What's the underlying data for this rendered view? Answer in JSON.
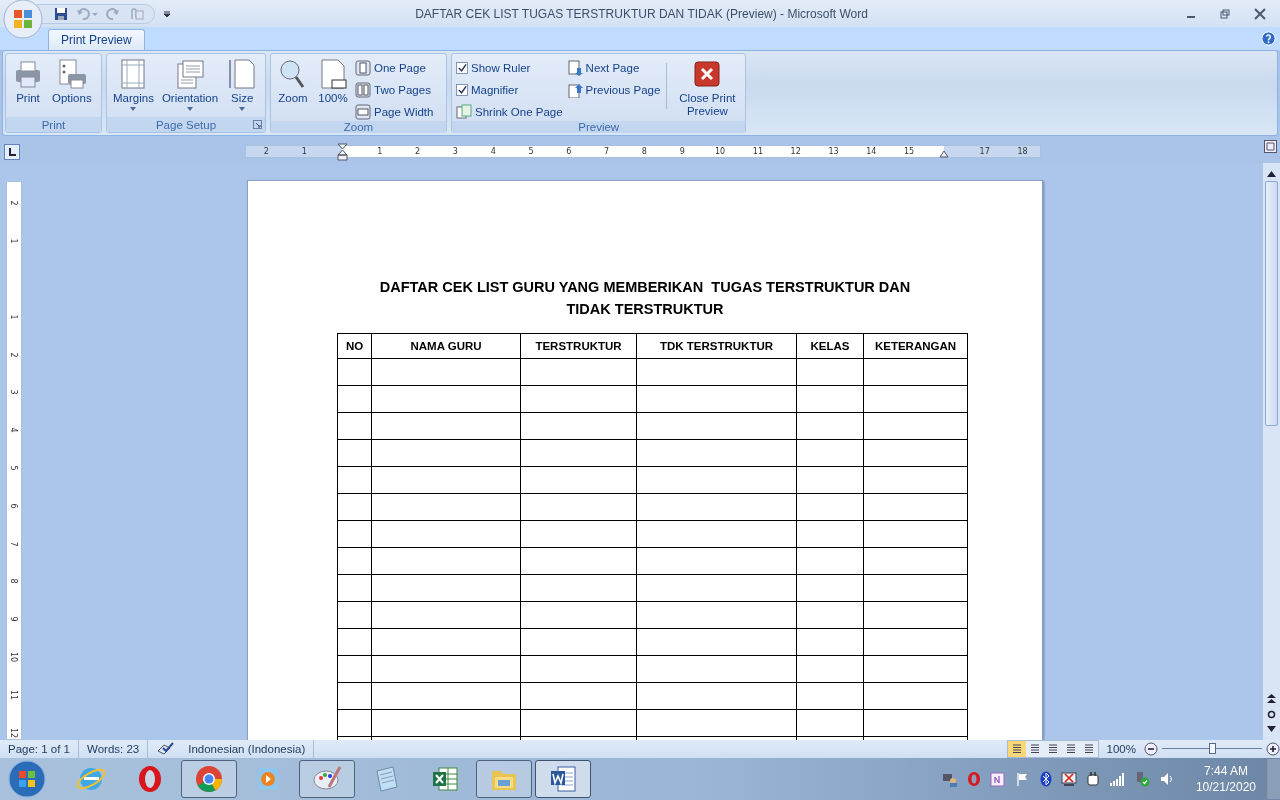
{
  "window": {
    "title": "DAFTAR CEK LIST TUGAS TERSTRUKTUR DAN TIDAK (Preview) - Microsoft Word"
  },
  "tabs": [
    {
      "label": "Print Preview",
      "selected": true
    }
  ],
  "ribbon": {
    "groups": [
      {
        "name": "Print",
        "columns": [
          [
            {
              "kind": "large",
              "label": "Print"
            }
          ],
          [
            {
              "kind": "large",
              "label": "Options"
            }
          ]
        ]
      },
      {
        "name": "Page Setup",
        "launcher": true,
        "columns": [
          [
            {
              "kind": "large",
              "label": "Margins",
              "dropdown": true
            }
          ],
          [
            {
              "kind": "large",
              "label": "Orientation",
              "dropdown": true
            }
          ],
          [
            {
              "kind": "large",
              "label": "Size",
              "dropdown": true
            }
          ]
        ]
      },
      {
        "name": "Zoom",
        "columns": [
          [
            {
              "kind": "large",
              "label": "Zoom"
            }
          ],
          [
            {
              "kind": "large",
              "label": "100%"
            }
          ],
          [
            {
              "kind": "small",
              "label": "One Page"
            },
            {
              "kind": "small",
              "label": "Two Pages"
            },
            {
              "kind": "small",
              "label": "Page Width"
            }
          ]
        ]
      },
      {
        "name": "Preview",
        "columns": [
          [
            {
              "kind": "check",
              "label": "Show Ruler",
              "checked": true
            },
            {
              "kind": "check",
              "label": "Magnifier",
              "checked": true
            },
            {
              "kind": "small",
              "label": "Shrink One Page"
            }
          ],
          [
            {
              "kind": "small",
              "label": "Next Page"
            },
            {
              "kind": "small",
              "label": "Previous Page"
            }
          ],
          [
            {
              "kind": "large",
              "label": "Close Print Preview"
            }
          ]
        ]
      }
    ]
  },
  "ruler": {
    "labels": [
      "2",
      "1",
      "1",
      "2",
      "3",
      "4",
      "5",
      "6",
      "7",
      "8",
      "9",
      "10",
      "11",
      "12",
      "13",
      "14",
      "15",
      "17",
      "18"
    ]
  },
  "vertical_ruler": {
    "labels": [
      "2",
      "1",
      "1",
      "2",
      "3",
      "4",
      "5",
      "6",
      "7",
      "8",
      "9",
      "10",
      "11",
      "12"
    ]
  },
  "document": {
    "title_lines": [
      "DAFTAR CEK LIST GURU YANG MEMBERIKAN  TUGAS TERSTRUKTUR DAN",
      "TIDAK TERSTRUKTUR"
    ],
    "table": {
      "columns": [
        "NO",
        "NAMA GURU",
        "TERSTRUKTUR",
        "TDK TERSTRUKTUR",
        "KELAS",
        "KETERANGAN"
      ],
      "rows": [
        {
          "kind": "blank"
        },
        {
          "kind": "blank"
        },
        {
          "kind": "blank"
        },
        {
          "kind": "blank"
        },
        {
          "kind": "blank"
        },
        {
          "kind": "blank"
        },
        {
          "kind": "blank"
        },
        {
          "kind": "blank"
        },
        {
          "kind": "blank"
        },
        {
          "kind": "blank"
        },
        {
          "kind": "blank"
        },
        {
          "kind": "blank"
        },
        {
          "kind": "blank"
        },
        {
          "kind": "blank"
        },
        {
          "kind": "blank"
        }
      ]
    }
  },
  "status_bar": {
    "page": "Page: 1 of 1",
    "words": "Words: 23",
    "language": "Indonesian (Indonesia)",
    "views": [
      {
        "selected": true
      },
      {
        "selected": false
      },
      {
        "selected": false
      },
      {
        "selected": false
      },
      {
        "selected": false
      }
    ],
    "zoom": "100%",
    "zoom_slider": {
      "level": 0.5
    }
  },
  "taskbar": {
    "apps": [
      {
        "running": false,
        "active": false
      },
      {
        "running": false,
        "active": false
      },
      {
        "running": true,
        "active": false
      },
      {
        "running": false,
        "active": false
      },
      {
        "running": true,
        "active": false
      },
      {
        "running": false,
        "active": false
      },
      {
        "running": false,
        "active": false
      },
      {
        "running": true,
        "active": false
      },
      {
        "running": true,
        "active": true
      }
    ],
    "time": "7:44 AM",
    "date": "10/21/2020"
  }
}
